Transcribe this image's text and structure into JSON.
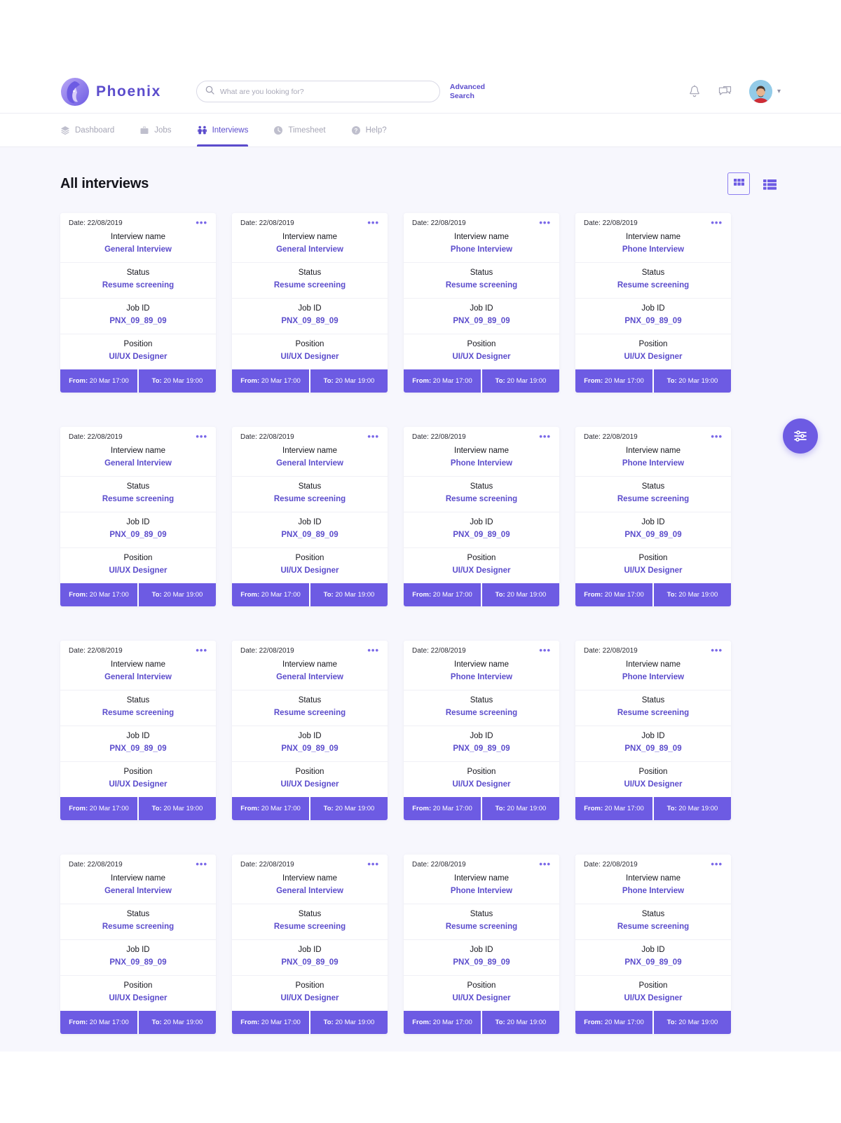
{
  "brand": {
    "name": "Phoenix",
    "logo_icon": "phoenix-bird-logo"
  },
  "search": {
    "placeholder": "What are you looking for?",
    "value": "",
    "icon": "search-icon",
    "advanced_label": "Advanced Search"
  },
  "header_actions": {
    "notifications_icon": "bell-icon",
    "messages_icon": "chat-bubble-icon",
    "avatar_name": "user-avatar",
    "chevron_icon": "chevron-down-icon"
  },
  "nav": {
    "items": [
      {
        "label": "Dashboard",
        "icon": "layers-icon",
        "active": false
      },
      {
        "label": "Jobs",
        "icon": "briefcase-icon",
        "active": false
      },
      {
        "label": "Interviews",
        "icon": "people-icon",
        "active": true
      },
      {
        "label": "Timesheet",
        "icon": "clock-icon",
        "active": false
      },
      {
        "label": "Help?",
        "icon": "question-circle-icon",
        "active": false
      }
    ]
  },
  "page": {
    "title": "All interviews",
    "view_grid_icon": "grid-view-icon",
    "view_list_icon": "list-view-icon",
    "active_view": "grid",
    "fab_icon": "filter-sliders-icon"
  },
  "labels": {
    "date_prefix": "Date:",
    "interview_name": "Interview name",
    "status": "Status",
    "job_id": "Job ID",
    "position": "Position",
    "from": "From:",
    "to": "To:",
    "menu_dots": "•••"
  },
  "colors": {
    "accent": "#6D5BE3",
    "accent_text": "#5B4CCC",
    "page_bg": "#F7F7FD",
    "card_bg": "#FFFFFF",
    "muted_text": "#A6A6B6"
  },
  "cards": [
    {
      "date": "22/08/2019",
      "interview_name": "General Interview",
      "status": "Resume screening",
      "job_id": "PNX_09_89_09",
      "position": "UI/UX Designer",
      "from": "20 Mar 17:00",
      "to": "20 Mar 19:00"
    },
    {
      "date": "22/08/2019",
      "interview_name": "General Interview",
      "status": "Resume screening",
      "job_id": "PNX_09_89_09",
      "position": "UI/UX Designer",
      "from": "20 Mar 17:00",
      "to": "20 Mar 19:00"
    },
    {
      "date": "22/08/2019",
      "interview_name": "Phone Interview",
      "status": "Resume screening",
      "job_id": "PNX_09_89_09",
      "position": "UI/UX Designer",
      "from": "20 Mar 17:00",
      "to": "20 Mar 19:00"
    },
    {
      "date": "22/08/2019",
      "interview_name": "Phone Interview",
      "status": "Resume screening",
      "job_id": "PNX_09_89_09",
      "position": "UI/UX Designer",
      "from": "20 Mar 17:00",
      "to": "20 Mar 19:00"
    },
    {
      "date": "22/08/2019",
      "interview_name": "General Interview",
      "status": "Resume screening",
      "job_id": "PNX_09_89_09",
      "position": "UI/UX Designer",
      "from": "20 Mar 17:00",
      "to": "20 Mar 19:00"
    },
    {
      "date": "22/08/2019",
      "interview_name": "General Interview",
      "status": "Resume screening",
      "job_id": "PNX_09_89_09",
      "position": "UI/UX Designer",
      "from": "20 Mar 17:00",
      "to": "20 Mar 19:00"
    },
    {
      "date": "22/08/2019",
      "interview_name": "Phone Interview",
      "status": "Resume screening",
      "job_id": "PNX_09_89_09",
      "position": "UI/UX Designer",
      "from": "20 Mar 17:00",
      "to": "20 Mar 19:00"
    },
    {
      "date": "22/08/2019",
      "interview_name": "Phone Interview",
      "status": "Resume screening",
      "job_id": "PNX_09_89_09",
      "position": "UI/UX Designer",
      "from": "20 Mar 17:00",
      "to": "20 Mar 19:00"
    },
    {
      "date": "22/08/2019",
      "interview_name": "General Interview",
      "status": "Resume screening",
      "job_id": "PNX_09_89_09",
      "position": "UI/UX Designer",
      "from": "20 Mar 17:00",
      "to": "20 Mar 19:00"
    },
    {
      "date": "22/08/2019",
      "interview_name": "General Interview",
      "status": "Resume screening",
      "job_id": "PNX_09_89_09",
      "position": "UI/UX Designer",
      "from": "20 Mar 17:00",
      "to": "20 Mar 19:00"
    },
    {
      "date": "22/08/2019",
      "interview_name": "Phone Interview",
      "status": "Resume screening",
      "job_id": "PNX_09_89_09",
      "position": "UI/UX Designer",
      "from": "20 Mar 17:00",
      "to": "20 Mar 19:00"
    },
    {
      "date": "22/08/2019",
      "interview_name": "Phone Interview",
      "status": "Resume screening",
      "job_id": "PNX_09_89_09",
      "position": "UI/UX Designer",
      "from": "20 Mar 17:00",
      "to": "20 Mar 19:00"
    },
    {
      "date": "22/08/2019",
      "interview_name": "General Interview",
      "status": "Resume screening",
      "job_id": "PNX_09_89_09",
      "position": "UI/UX Designer",
      "from": "20 Mar 17:00",
      "to": "20 Mar 19:00"
    },
    {
      "date": "22/08/2019",
      "interview_name": "General Interview",
      "status": "Resume screening",
      "job_id": "PNX_09_89_09",
      "position": "UI/UX Designer",
      "from": "20 Mar 17:00",
      "to": "20 Mar 19:00"
    },
    {
      "date": "22/08/2019",
      "interview_name": "Phone Interview",
      "status": "Resume screening",
      "job_id": "PNX_09_89_09",
      "position": "UI/UX Designer",
      "from": "20 Mar 17:00",
      "to": "20 Mar 19:00"
    },
    {
      "date": "22/08/2019",
      "interview_name": "Phone Interview",
      "status": "Resume screening",
      "job_id": "PNX_09_89_09",
      "position": "UI/UX Designer",
      "from": "20 Mar 17:00",
      "to": "20 Mar 19:00"
    }
  ]
}
